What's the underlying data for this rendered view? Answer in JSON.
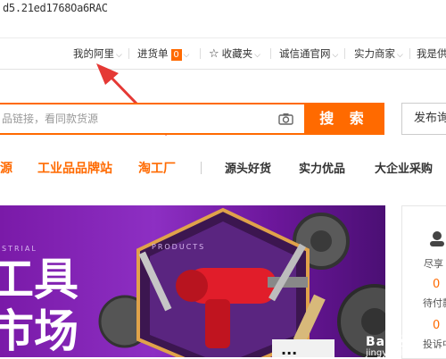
{
  "browser": {
    "url_fragment": "d5.21ed1768Oa6RAC"
  },
  "topnav": {
    "my_alibaba": "我的阿里",
    "purchase_list": "进货单",
    "purchase_count": "0",
    "favorites": "收藏夹",
    "trust_pass": "诚信通官网",
    "strong_merchant": "实力商家",
    "i_am_supplier": "我是供"
  },
  "search": {
    "placeholder": "品链接，看同款货源",
    "button_label": "搜 索"
  },
  "publish_button": "发布询",
  "categories": {
    "source_partial": "源",
    "industrial_brand": "工业品品牌站",
    "taogongchang": "淘工厂",
    "source_goods": "源头好货",
    "strength_quality": "实力优品",
    "enterprise_purchase": "大企业采购"
  },
  "banner": {
    "arc_text_left": "STRIAL",
    "arc_text_right": "PRODUCTS",
    "headline_1": "工具",
    "headline_2": "市场"
  },
  "side_panel": {
    "greeting": "尽享",
    "pending_count": "0",
    "pending_label": "待付款",
    "complaint_count": "0",
    "complaint_label": "投诉中"
  },
  "watermark": {
    "brand": "Bai经验",
    "site": "jingyan.baidu.com"
  },
  "colors": {
    "accent": "#ff6a00",
    "banner_purple": "#7a1aa8",
    "arrow_red": "#e53935"
  }
}
